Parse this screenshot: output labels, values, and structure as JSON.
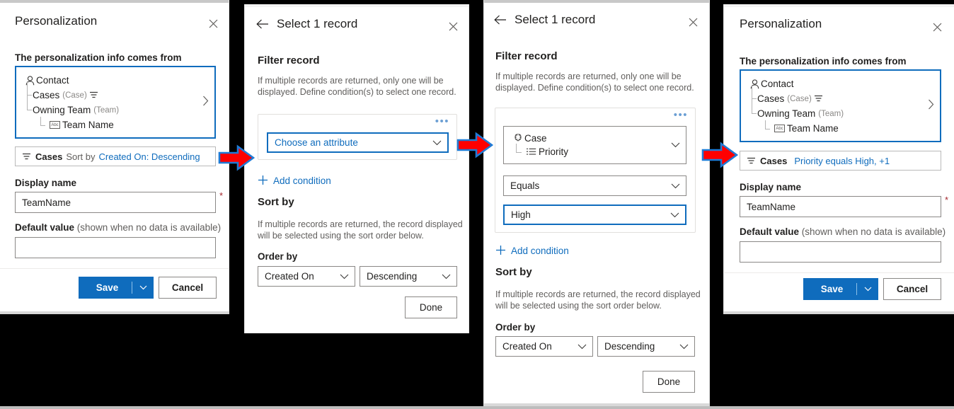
{
  "panels": [
    {
      "id": "personalization-initial",
      "title": "Personalization",
      "close_label": "Close",
      "source_label": "The personalization info comes from",
      "tree": [
        {
          "label": "Contact",
          "sub": "",
          "icon": "contact-icon",
          "depth": 0
        },
        {
          "label": "Cases",
          "sub": "(Case)",
          "icon": "filter-icon",
          "depth": 1
        },
        {
          "label": "Owning Team",
          "sub": "(Team)",
          "icon": "",
          "depth": 1
        },
        {
          "label": "Team Name",
          "sub": "",
          "icon": "abc-text-icon",
          "depth": 2
        }
      ],
      "filter_bar": {
        "entity": "Cases",
        "middle": "Sort by",
        "link": "Created On: Descending"
      },
      "display_name_label": "Display name",
      "display_name_value": "TeamName",
      "required_marker": "*",
      "default_value_label": "Default value",
      "default_value_hint": "(shown when no data is available)",
      "default_value_value": "",
      "save_label": "Save",
      "cancel_label": "Cancel"
    },
    {
      "id": "select-record-empty",
      "title": "Select 1 record",
      "back_label": "Back",
      "close_label": "Close",
      "filter_section_title": "Filter record",
      "filter_help": "If multiple records are returned, only one will be displayed. Define condition(s) to select one record.",
      "overflow_label": "•••",
      "attribute_placeholder": "Choose an attribute",
      "add_condition_label": "Add condition",
      "sort_section_title": "Sort by",
      "sort_help": "If multiple records are returned, the record displayed will be selected using the sort order below.",
      "order_by_label": "Order by",
      "order_by_field": "Created On",
      "order_by_direction": "Descending",
      "done_label": "Done"
    },
    {
      "id": "select-record-filled",
      "title": "Select 1 record",
      "back_label": "Back",
      "close_label": "Close",
      "filter_section_title": "Filter record",
      "filter_help": "If multiple records are returned, only one will be displayed. Define condition(s) to select one record.",
      "overflow_label": "•••",
      "attribute_entity": "Case",
      "attribute_field": "Priority",
      "operator_value": "Equals",
      "condition_value": "High",
      "add_condition_label": "Add condition",
      "sort_section_title": "Sort by",
      "sort_help": "If multiple records are returned, the record displayed will be selected using the sort order below.",
      "order_by_label": "Order by",
      "order_by_field": "Created On",
      "order_by_direction": "Descending",
      "done_label": "Done"
    },
    {
      "id": "personalization-final",
      "title": "Personalization",
      "close_label": "Close",
      "source_label": "The personalization info comes from",
      "tree": [
        {
          "label": "Contact",
          "sub": "",
          "icon": "contact-icon",
          "depth": 0
        },
        {
          "label": "Cases",
          "sub": "(Case)",
          "icon": "filter-icon",
          "depth": 1
        },
        {
          "label": "Owning Team",
          "sub": "(Team)",
          "icon": "",
          "depth": 1
        },
        {
          "label": "Team Name",
          "sub": "",
          "icon": "abc-text-icon",
          "depth": 2
        }
      ],
      "filter_bar": {
        "entity": "Cases",
        "middle": "",
        "link": "Priority equals High, +1"
      },
      "display_name_label": "Display name",
      "display_name_value": "TeamName",
      "required_marker": "*",
      "default_value_label": "Default value",
      "default_value_hint": "(shown when no data is available)",
      "default_value_value": "",
      "save_label": "Save",
      "cancel_label": "Cancel"
    }
  ],
  "arrows": [
    {
      "name": "flow-arrow-1",
      "direction": "right"
    },
    {
      "name": "flow-arrow-2",
      "direction": "right"
    },
    {
      "name": "flow-arrow-3",
      "direction": "right"
    }
  ],
  "colors": {
    "accent": "#0f6cbd",
    "link": "#0f6cbd",
    "required": "#a4262c",
    "arrow_fill": "#ff0000",
    "arrow_stroke": "#1f7bd6",
    "background": "#000000",
    "panel_bg": "#ffffff",
    "text": "#201f1e",
    "muted_text": "#605e5c"
  }
}
